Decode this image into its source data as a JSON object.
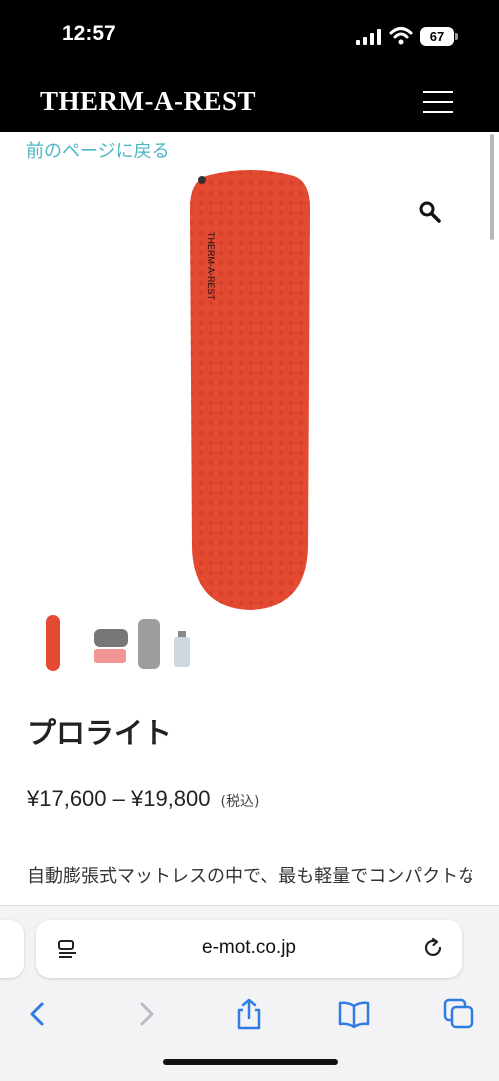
{
  "status": {
    "time": "12:57",
    "battery": "67"
  },
  "header": {
    "brand": "THERM-A-REST",
    "menu_icon": "hamburger-icon"
  },
  "page": {
    "back_link": "前のページに戻る",
    "zoom_icon": "magnifier-icon",
    "product_title": "プロライト",
    "price": "¥17,600 – ¥19,800",
    "tax_note": "(税込)",
    "description": "自動膨張式マットレスの中で、最も軽量でコンパクトなモデルです。空気を抱っに含み、軽量でコ",
    "thumbnails": [
      "mat-red",
      "mat-packed",
      "mat-bag",
      "bottle"
    ]
  },
  "browser": {
    "url": "e-mot.co.jp",
    "icons": [
      "back-icon",
      "forward-icon",
      "share-icon",
      "bookmarks-icon",
      "tabs-icon"
    ]
  },
  "colors": {
    "accent": "#4db7c4",
    "product_red": "#e14a33"
  }
}
